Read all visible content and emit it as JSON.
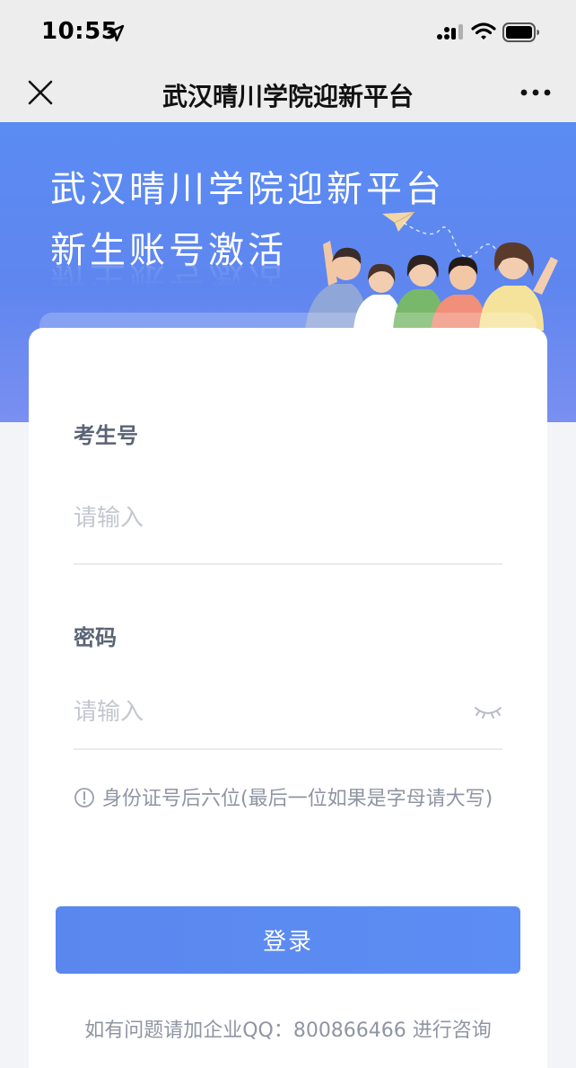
{
  "status_bar": {
    "time": "10:55",
    "icons": [
      "location-arrow-icon",
      "cellular-signal-icon",
      "wifi-icon",
      "battery-icon"
    ]
  },
  "nav": {
    "title": "武汉晴川学院迎新平台",
    "close_icon": "close-icon",
    "more_icon": "more-icon"
  },
  "banner": {
    "title": "武汉晴川学院迎新平台",
    "subtitle": "新生账号激活",
    "gradient_colors": [
      "#5a8cf3",
      "#7a8ff1"
    ]
  },
  "form": {
    "exam_number": {
      "label": "考生号",
      "placeholder": "请输入",
      "value": ""
    },
    "password": {
      "label": "密码",
      "placeholder": "请输入",
      "value": "",
      "toggle_icon": "eye-closed-icon"
    },
    "hint": "身份证号后六位(最后一位如果是字母请大写)",
    "submit_label": "登录",
    "contact": "如有问题请加企业QQ：800866466 进行咨询"
  },
  "colors": {
    "accent": "#5b8af1",
    "label": "#5b6475",
    "muted": "#8f95a3",
    "placeholder": "#c3c7cf"
  }
}
